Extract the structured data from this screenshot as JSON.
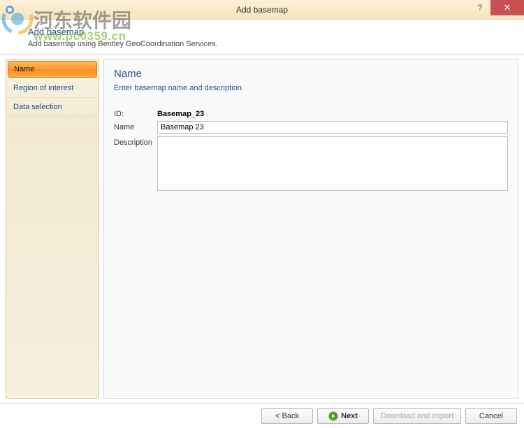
{
  "titlebar": {
    "title": "Add basemap",
    "help": "?",
    "close": "✕"
  },
  "header": {
    "title": "Add basemap",
    "subtitle": "Add basemap using Bentley GeoCoordination Services."
  },
  "sidebar": {
    "items": [
      {
        "label": "Name",
        "active": true
      },
      {
        "label": "Region of interest",
        "active": false
      },
      {
        "label": "Data selection",
        "active": false
      }
    ]
  },
  "content": {
    "step_title": "Name",
    "step_subtitle": "Enter basemap name and description.",
    "id_label": "ID:",
    "id_value": "Basemap_23",
    "name_label": "Name",
    "name_value": "Basemap 23",
    "description_label": "Description",
    "description_value": ""
  },
  "footer": {
    "back": "< Back",
    "next": "Next",
    "download": "Download and import",
    "cancel": "Cancel"
  },
  "watermark": {
    "text1": "河东软件园",
    "text2": "www.pc0359.cn"
  }
}
